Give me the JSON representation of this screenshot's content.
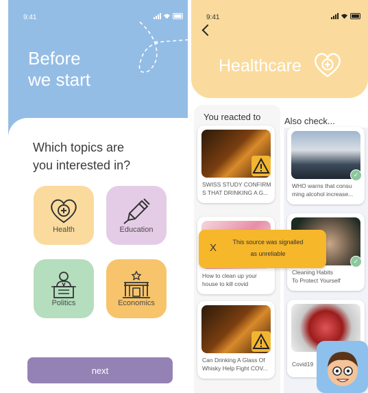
{
  "left_screen": {
    "status_time": "9:41",
    "hero_title": "Before\nwe start",
    "question": "Which topics are\nyou interested in?",
    "topics": [
      {
        "label": "Health",
        "icon": "heart-icon",
        "color": "#FADB9D"
      },
      {
        "label": "Education",
        "icon": "pen-icon",
        "color": "#E4CCE6"
      },
      {
        "label": "Politics",
        "icon": "speaker-icon",
        "color": "#B4DEBD"
      },
      {
        "label": "Economics",
        "icon": "building-icon",
        "color": "#F7C46C"
      }
    ],
    "next_label": "next"
  },
  "right_screen": {
    "status_time": "9:41",
    "title": "Healthcare",
    "column_reacted": "You reacted to",
    "column_also": "Also check...",
    "reacted_items": [
      {
        "caption": "SWISS STUDY CONFIRM\nS THAT DRINKING A G...",
        "badge": "warning-icon"
      },
      {
        "caption": "How to clean up your\nhouse to kill covid",
        "badge": ""
      },
      {
        "caption": "Can Drinking A Glass Of\nWhisky Help Fight COV...",
        "badge": "warning-icon"
      }
    ],
    "also_items": [
      {
        "caption": "WHO warns that consu\nming alcohol increase...",
        "badge": "check-icon"
      },
      {
        "caption": "Cleaning Habits\nTo Protect Yourself",
        "badge": "check-icon"
      },
      {
        "caption": "Covid19",
        "badge": ""
      }
    ],
    "toast": {
      "close": "X",
      "message": "This source was signalled\nas unreliable"
    }
  },
  "colors": {
    "hero_blue": "#94BDE6",
    "header_yellow": "#FADB9D",
    "next_purple": "#9582B5",
    "toast_orange": "#F7B72A"
  }
}
